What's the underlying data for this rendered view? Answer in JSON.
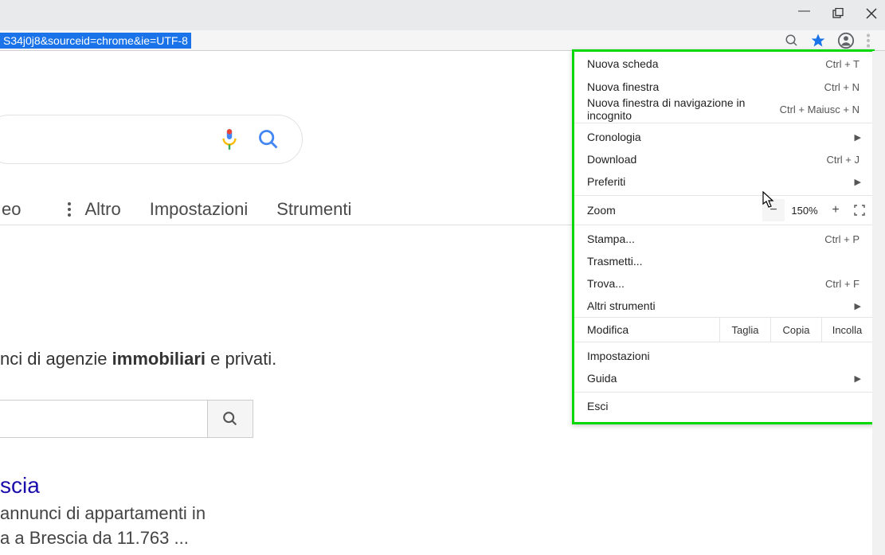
{
  "window": {
    "url_fragment": "S34j0j8&sourceid=chrome&ie=UTF-8"
  },
  "search_nav": {
    "truncated_tab": "eo",
    "more": "Altro",
    "settings": "Impostazioni",
    "tools": "Strumenti"
  },
  "results": {
    "snippet_prefix": "nci di agenzie ",
    "snippet_bold": "immobiliari",
    "snippet_suffix": " e privati.",
    "title_fragment": "scia",
    "desc_line1": "annunci di appartamenti in",
    "desc_line2": "a a Brescia da 11.763 ..."
  },
  "menu": {
    "new_tab": {
      "label": "Nuova scheda",
      "shortcut": "Ctrl + T"
    },
    "new_window": {
      "label": "Nuova finestra",
      "shortcut": "Ctrl + N"
    },
    "incognito": {
      "label": "Nuova finestra di navigazione in incognito",
      "shortcut": "Ctrl + Maiusc + N"
    },
    "history": {
      "label": "Cronologia"
    },
    "downloads": {
      "label": "Download",
      "shortcut": "Ctrl + J"
    },
    "bookmarks": {
      "label": "Preferiti"
    },
    "zoom": {
      "label": "Zoom",
      "value": "150%"
    },
    "print": {
      "label": "Stampa...",
      "shortcut": "Ctrl + P"
    },
    "cast": {
      "label": "Trasmetti..."
    },
    "find": {
      "label": "Trova...",
      "shortcut": "Ctrl + F"
    },
    "more_tools": {
      "label": "Altri strumenti"
    },
    "edit": {
      "label": "Modifica",
      "cut": "Taglia",
      "copy": "Copia",
      "paste": "Incolla"
    },
    "settings": {
      "label": "Impostazioni"
    },
    "help": {
      "label": "Guida"
    },
    "exit": {
      "label": "Esci"
    }
  }
}
